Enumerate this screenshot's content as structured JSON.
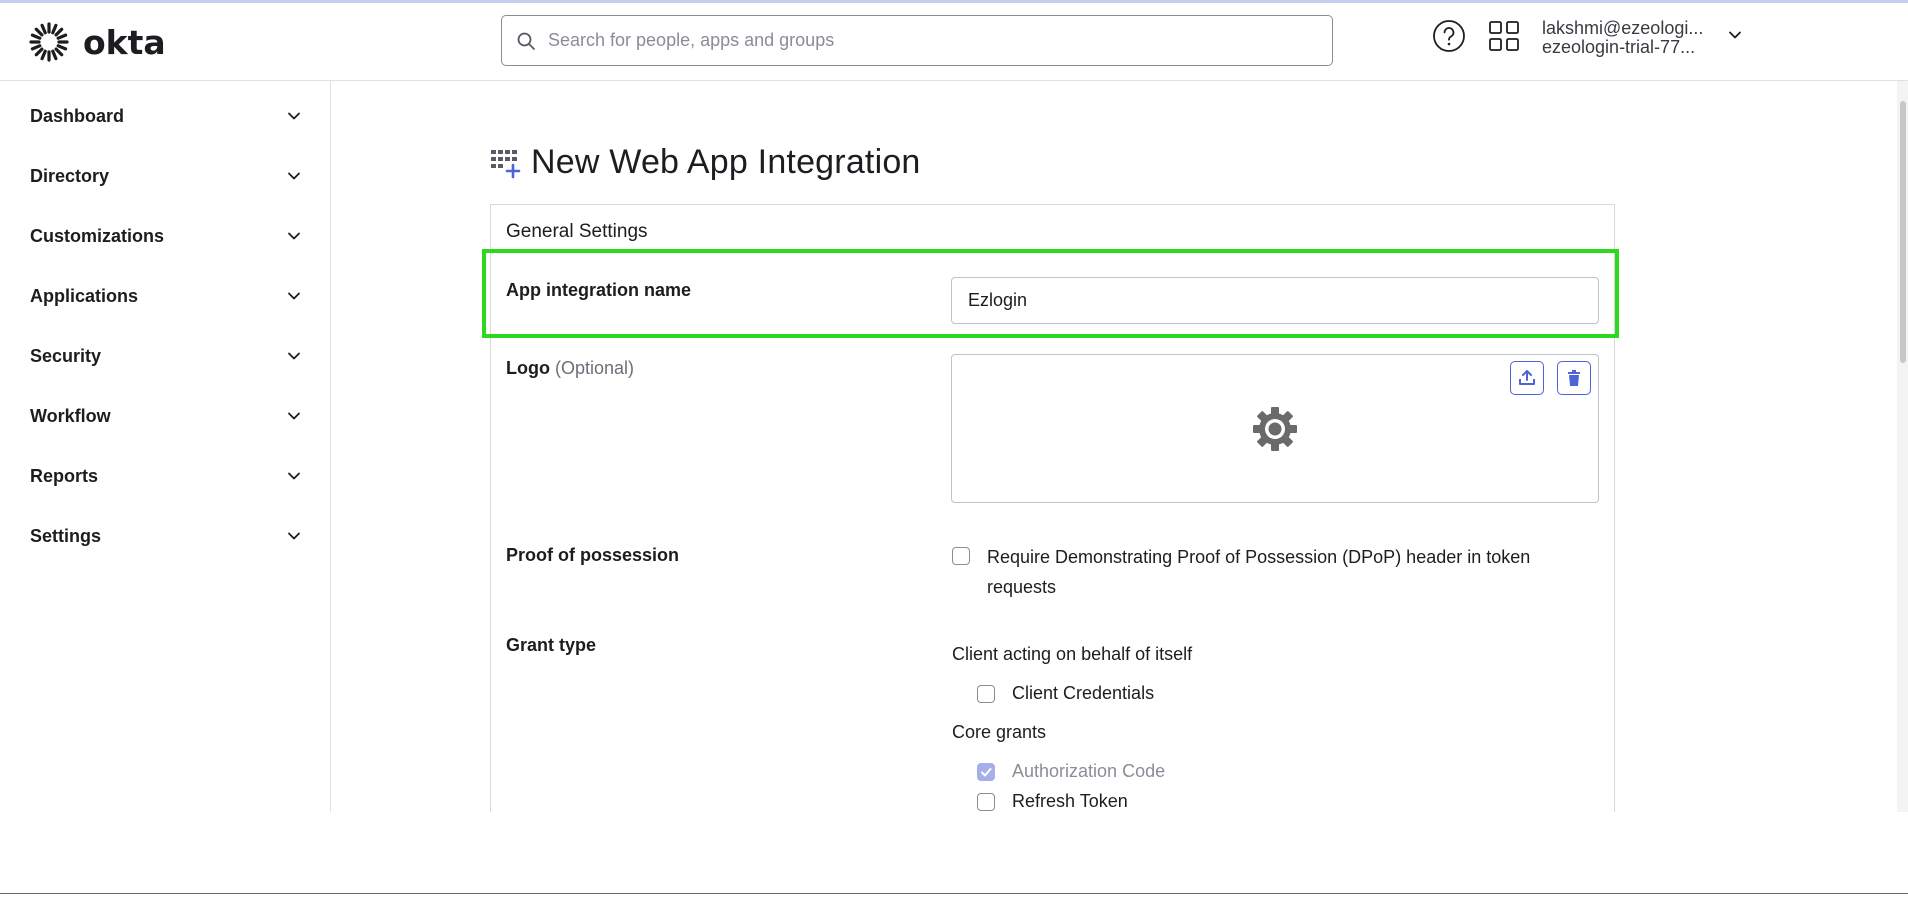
{
  "header": {
    "brand": "okta",
    "search": {
      "placeholder": "Search for people, apps and groups",
      "value": ""
    },
    "user": {
      "email": "lakshmi@ezeologi...",
      "org": "ezeologin-trial-77..."
    }
  },
  "sidebar": {
    "items": [
      {
        "label": "Dashboard"
      },
      {
        "label": "Directory"
      },
      {
        "label": "Customizations"
      },
      {
        "label": "Applications"
      },
      {
        "label": "Security"
      },
      {
        "label": "Workflow"
      },
      {
        "label": "Reports"
      },
      {
        "label": "Settings"
      }
    ]
  },
  "main": {
    "title": "New Web App Integration",
    "section_title": "General Settings",
    "app_name": {
      "label": "App integration name",
      "value": "Ezlogin"
    },
    "logo": {
      "label": "Logo",
      "optional": "(Optional)",
      "upload_icon": "upload-icon",
      "delete_icon": "trash-icon"
    },
    "proof_of_possession": {
      "label": "Proof of possession",
      "checkbox_label": "Require Demonstrating Proof of Possession (DPoP) header in token requests",
      "checked": false
    },
    "grant_type": {
      "label": "Grant type",
      "client_group": "Client acting on behalf of itself",
      "client_credentials": {
        "label": "Client Credentials",
        "checked": false
      },
      "core_group": "Core grants",
      "authorization_code": {
        "label": "Authorization Code",
        "checked": true,
        "disabled": true
      },
      "refresh_token": {
        "label": "Refresh Token",
        "checked": false
      }
    }
  },
  "colors": {
    "highlight": "#2ed81f",
    "accent": "#4c64d8",
    "checked_disabled": "#a5b0e8"
  }
}
